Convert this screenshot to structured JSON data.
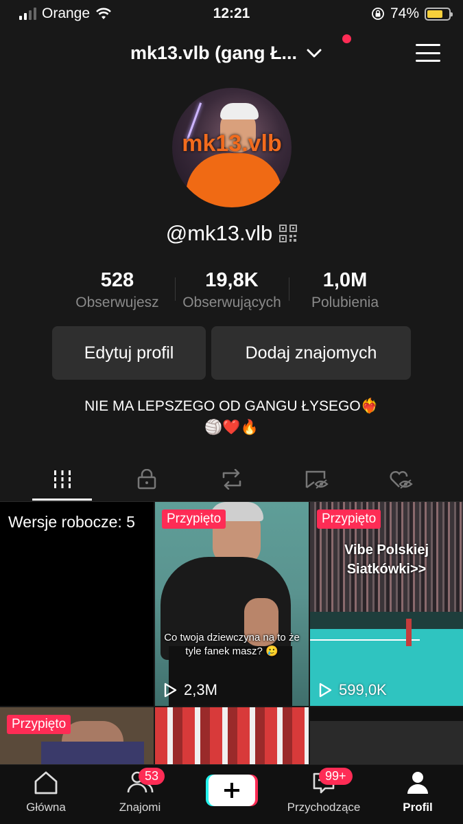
{
  "status_bar": {
    "carrier": "Orange",
    "time": "12:21",
    "battery_percent": "74%",
    "battery_level": 0.74,
    "icons": [
      "signal-icon",
      "wifi-icon",
      "orientation-lock-icon",
      "battery-icon"
    ]
  },
  "header": {
    "account_name": "mk13.vlb  (gang Ł...",
    "has_notification": true
  },
  "profile": {
    "avatar_text": "mk13.vlb",
    "handle": "@mk13.vlb",
    "stats": [
      {
        "value": "528",
        "label": "Obserwujesz"
      },
      {
        "value": "19,8K",
        "label": "Obserwujących"
      },
      {
        "value": "1,0M",
        "label": "Polubienia"
      }
    ],
    "edit_button": "Edytuj profil",
    "add_friends_button": "Dodaj znajomych",
    "bio_line1": "NIE MA LEPSZEGO OD GANGU ŁYSEGO",
    "bio_line1_emoji": "❤️‍🔥",
    "bio_line2": "🏐❤️🔥"
  },
  "tabs": [
    "grid-icon",
    "lock-icon",
    "repost-icon",
    "favorites-icon",
    "liked-icon"
  ],
  "grid": {
    "drafts_label": "Wersje robocze: 5",
    "items": [
      {
        "pinned": "Przypięto",
        "caption": "Co twoja dziewczyna na to że tyle fanek masz? 🥲",
        "views": "2,3M"
      },
      {
        "pinned": "Przypięto",
        "title": "Vibe Polskiej Siatkówki>>",
        "views": "599,0K"
      },
      {
        "pinned": "Przypięto"
      }
    ]
  },
  "bottom_nav": {
    "items": [
      {
        "label": "Główna"
      },
      {
        "label": "Znajomi",
        "badge": "53"
      },
      {
        "label": ""
      },
      {
        "label": "Przychodzące",
        "badge": "99+"
      },
      {
        "label": "Profil"
      }
    ]
  },
  "colors": {
    "background": "#181818",
    "accent": "#fe2c55",
    "cyan": "#25f4ee",
    "button_bg": "#2f2f2f"
  }
}
